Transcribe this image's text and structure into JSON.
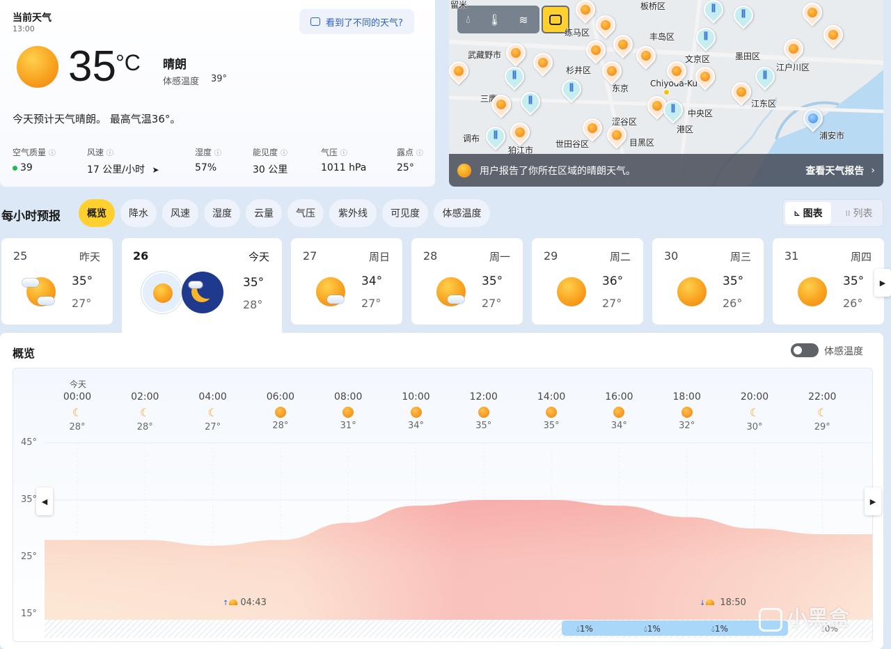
{
  "current": {
    "title": "当前天气",
    "time": "13:00",
    "feedback_button": "看到了不同的天气?",
    "temp": "35",
    "unit": "°C",
    "condition": "晴朗",
    "feels_label": "体感温度",
    "feels_value": "39°",
    "summary": "今天预计天气晴朗。 最高气温36°。",
    "metrics": [
      {
        "label": "空气质量",
        "value": "39"
      },
      {
        "label": "风速",
        "value": "17 公里/小时"
      },
      {
        "label": "湿度",
        "value": "57%"
      },
      {
        "label": "能见度",
        "value": "30 公里"
      },
      {
        "label": "气压",
        "value": "1011 hPa"
      },
      {
        "label": "露点",
        "value": "25°"
      }
    ],
    "aqi_color": "#1db954"
  },
  "map": {
    "labels": [
      "留米",
      "板桥区",
      "练马区",
      "丰岛区",
      "武藏野市",
      "文京区",
      "墨田区",
      "杉井区",
      "江户川区",
      "Chiyoda-Ku",
      "东京",
      "三鹰",
      "中央区",
      "江东区",
      "涩谷区",
      "港区",
      "调布",
      "世田谷区",
      "目黑区",
      "浦安市",
      "狛江市"
    ],
    "report_text": "用户报告了你所在区域的晴朗天气。",
    "report_link": "查看天气报告"
  },
  "hourly": {
    "title": "每小时预报",
    "tabs": [
      "概览",
      "降水",
      "风速",
      "湿度",
      "云量",
      "气压",
      "紫外线",
      "可见度",
      "体感温度"
    ],
    "active_tab": "概览",
    "view_chart": "图表",
    "view_list": "列表"
  },
  "days": [
    {
      "date": "25",
      "weekday": "昨天",
      "high": "35°",
      "low": "27°",
      "icon": "sun-cloud-icon"
    },
    {
      "date": "26",
      "weekday": "今天",
      "high": "35°",
      "low": "28°",
      "icon": "sun-moon-icon"
    },
    {
      "date": "27",
      "weekday": "周日",
      "high": "34°",
      "low": "27°",
      "icon": "sun-cloud-icon"
    },
    {
      "date": "28",
      "weekday": "周一",
      "high": "35°",
      "low": "27°",
      "icon": "sun-cloud-icon"
    },
    {
      "date": "29",
      "weekday": "周二",
      "high": "36°",
      "low": "27°",
      "icon": "sun-icon"
    },
    {
      "date": "30",
      "weekday": "周三",
      "high": "35°",
      "low": "26°",
      "icon": "sun-icon"
    },
    {
      "date": "31",
      "weekday": "周四",
      "high": "35°",
      "low": "26°",
      "icon": "sun-icon"
    }
  ],
  "overview": {
    "title": "概览",
    "toggle_label": "体感温度",
    "today_label": "今天",
    "hours": [
      {
        "time": "00:00",
        "icon": "moon-icon",
        "temp": "28°"
      },
      {
        "time": "02:00",
        "icon": "moon-icon",
        "temp": "28°"
      },
      {
        "time": "04:00",
        "icon": "moon-icon",
        "temp": "27°"
      },
      {
        "time": "06:00",
        "icon": "sun-icon",
        "temp": "28°"
      },
      {
        "time": "08:00",
        "icon": "sun-icon",
        "temp": "31°"
      },
      {
        "time": "10:00",
        "icon": "sun-icon",
        "temp": "34°"
      },
      {
        "time": "12:00",
        "icon": "sun-icon",
        "temp": "35°"
      },
      {
        "time": "14:00",
        "icon": "sun-icon",
        "temp": "35°"
      },
      {
        "time": "16:00",
        "icon": "sun-icon",
        "temp": "34°"
      },
      {
        "time": "18:00",
        "icon": "sun-icon",
        "temp": "32°"
      },
      {
        "time": "20:00",
        "icon": "moon-icon",
        "temp": "30°"
      },
      {
        "time": "22:00",
        "icon": "moon-icon",
        "temp": "29°"
      }
    ],
    "y_ticks": [
      "45°",
      "35°",
      "25°",
      "15°"
    ],
    "sunrise": "04:43",
    "sunset": "18:50",
    "precip": [
      "1%",
      "1%",
      "1%",
      "0%"
    ]
  },
  "watermark": "小黑盒",
  "chart_data": {
    "type": "area",
    "x": [
      "00:00",
      "02:00",
      "04:00",
      "06:00",
      "08:00",
      "10:00",
      "12:00",
      "14:00",
      "16:00",
      "18:00",
      "20:00",
      "22:00"
    ],
    "values": [
      28,
      28,
      27,
      28,
      31,
      34,
      35,
      35,
      34,
      32,
      30,
      29
    ],
    "ylim": [
      15,
      45
    ],
    "yticks": [
      "45°",
      "35°",
      "25°",
      "15°"
    ]
  }
}
